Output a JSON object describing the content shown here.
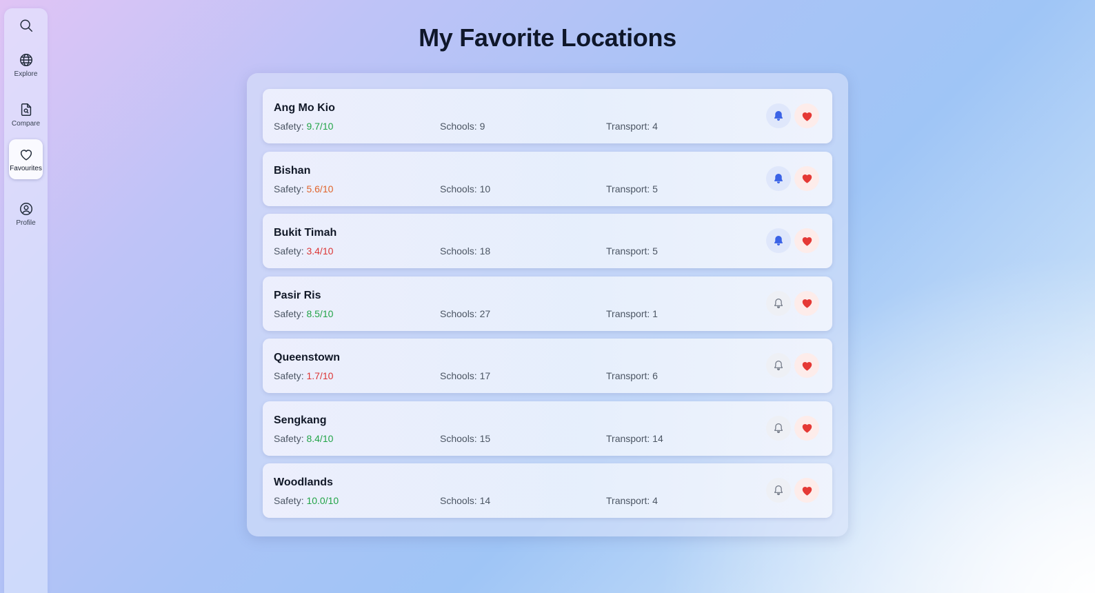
{
  "sidebar": {
    "search_icon": "search-icon",
    "items": [
      {
        "label": "Explore",
        "icon": "globe-icon"
      },
      {
        "label": "Compare",
        "icon": "document-search-icon"
      },
      {
        "label": "Favourites",
        "icon": "heart-icon",
        "active": true
      },
      {
        "label": "Profile",
        "icon": "user-circle-icon"
      }
    ]
  },
  "page": {
    "title": "My Favorite Locations"
  },
  "labels": {
    "safety": "Safety: ",
    "schools": "Schools: ",
    "transport": "Transport: "
  },
  "colors": {
    "safety_good": "#22a447",
    "safety_mid": "#e0632a",
    "safety_bad": "#dc3535",
    "bell_active": "#3b63e6",
    "heart": "#e53935"
  },
  "locations": [
    {
      "name": "Ang Mo Kio",
      "safety": "9.7/10",
      "safety_level": "good",
      "schools": "9",
      "transport": "4",
      "notify": true
    },
    {
      "name": "Bishan",
      "safety": "5.6/10",
      "safety_level": "mid",
      "schools": "10",
      "transport": "5",
      "notify": true
    },
    {
      "name": "Bukit Timah",
      "safety": "3.4/10",
      "safety_level": "bad",
      "schools": "18",
      "transport": "5",
      "notify": true
    },
    {
      "name": "Pasir Ris",
      "safety": "8.5/10",
      "safety_level": "good",
      "schools": "27",
      "transport": "1",
      "notify": false
    },
    {
      "name": "Queenstown",
      "safety": "1.7/10",
      "safety_level": "bad",
      "schools": "17",
      "transport": "6",
      "notify": false
    },
    {
      "name": "Sengkang",
      "safety": "8.4/10",
      "safety_level": "good",
      "schools": "15",
      "transport": "14",
      "notify": false
    },
    {
      "name": "Woodlands",
      "safety": "10.0/10",
      "safety_level": "good",
      "schools": "14",
      "transport": "4",
      "notify": false
    }
  ]
}
